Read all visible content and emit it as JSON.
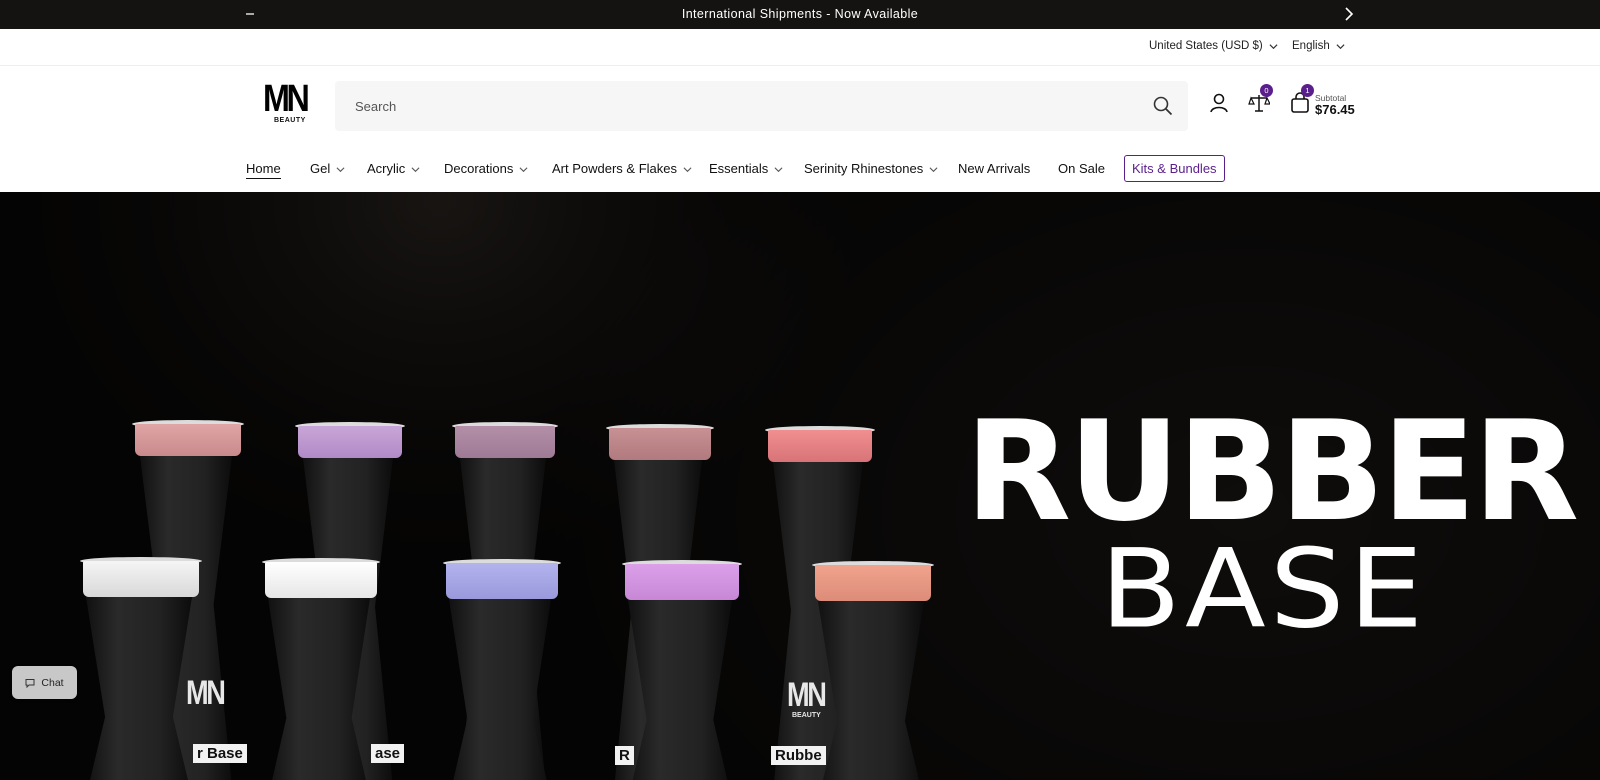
{
  "announcement": {
    "message": "International Shipments - Now Available"
  },
  "utility": {
    "country": "United States (USD $)",
    "language": "English"
  },
  "header": {
    "logo_mark": "MN",
    "logo_sub": "BEAUTY",
    "search_placeholder": "Search",
    "compare_count": "0",
    "cart_count": "1",
    "subtotal_label": "Subtotal",
    "subtotal_amount": "$76.45"
  },
  "nav": {
    "items": [
      {
        "label": "Home"
      },
      {
        "label": "Gel"
      },
      {
        "label": "Acrylic"
      },
      {
        "label": "Decorations"
      },
      {
        "label": "Art Powders & Flakes"
      },
      {
        "label": "Essentials"
      },
      {
        "label": "Serinity Rhinestones"
      },
      {
        "label": "New Arrivals"
      },
      {
        "label": "On Sale"
      },
      {
        "label": "Kits & Bundles"
      }
    ]
  },
  "hero": {
    "title": "RUBBER",
    "subtitle": "BASE",
    "bottle_mark": "MN",
    "bottle_mark_sub": "BEAUTY",
    "label_fragments": [
      "r Base",
      "ase",
      "R",
      "Rubbe"
    ]
  },
  "chat": {
    "label": "Chat"
  },
  "colors": {
    "accent": "#5a1f8c",
    "announcement_bg": "#151311"
  }
}
